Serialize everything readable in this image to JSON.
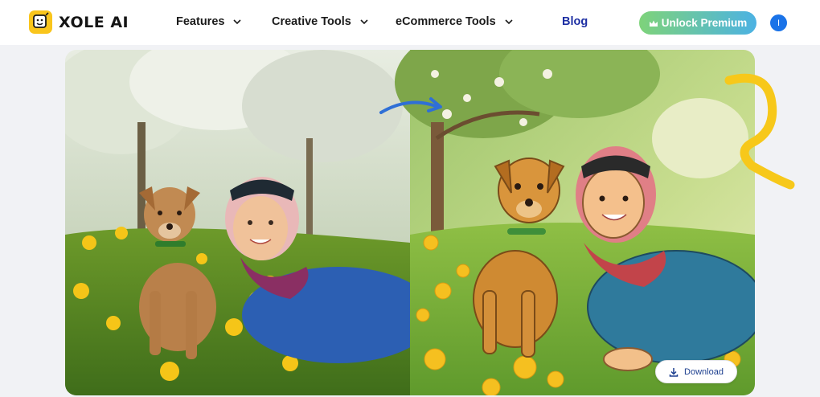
{
  "brand": {
    "name": "XOLE AI",
    "logo_icon": "smile-face-icon",
    "logo_color": "#f9c51c"
  },
  "nav": {
    "items": [
      {
        "label": "Features",
        "has_dropdown": true
      },
      {
        "label": "Creative Tools",
        "has_dropdown": true
      },
      {
        "label": "eCommerce Tools",
        "has_dropdown": true
      },
      {
        "label": "Blog",
        "has_dropdown": false,
        "color": "#1d2fa3"
      }
    ]
  },
  "actions": {
    "premium_label": "Unlock Premium",
    "premium_icon": "crown-icon",
    "avatar_initial": "I",
    "avatar_color": "#1a73e8"
  },
  "showcase": {
    "left_image": "photo-woman-and-dog-in-dandelion-meadow",
    "right_image": "cartoon-woman-and-dog-in-dandelion-meadow",
    "arrow_icon": "curved-arrow-icon",
    "decor": "yellow-squiggle-icon",
    "download_label": "Download",
    "download_icon": "download-icon"
  }
}
